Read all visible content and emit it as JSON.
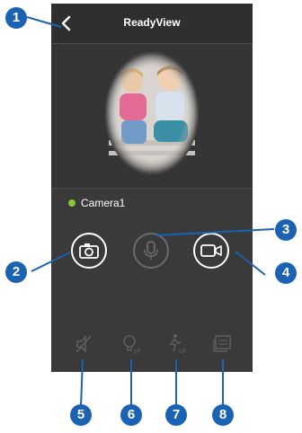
{
  "app": {
    "title": "ReadyView",
    "camera_name": "Camera1",
    "camera_status_color": "#8ac43f"
  },
  "controls": {
    "snapshot": {
      "icon": "camera-icon"
    },
    "talk": {
      "icon": "microphone-icon",
      "state": "disabled"
    },
    "record": {
      "icon": "video-record-icon"
    }
  },
  "toolbar": {
    "mute": {
      "icon": "speaker-mute-icon"
    },
    "light": {
      "icon": "light-bulb-icon",
      "badge": "off"
    },
    "motion": {
      "icon": "motion-detect-icon",
      "badge": "off"
    },
    "gallery": {
      "icon": "gallery-icon"
    }
  },
  "callouts": [
    "1",
    "2",
    "3",
    "4",
    "5",
    "6",
    "7",
    "8"
  ],
  "colors": {
    "callout": "#1b62b3",
    "screen_bg": "#3a3a3a"
  }
}
